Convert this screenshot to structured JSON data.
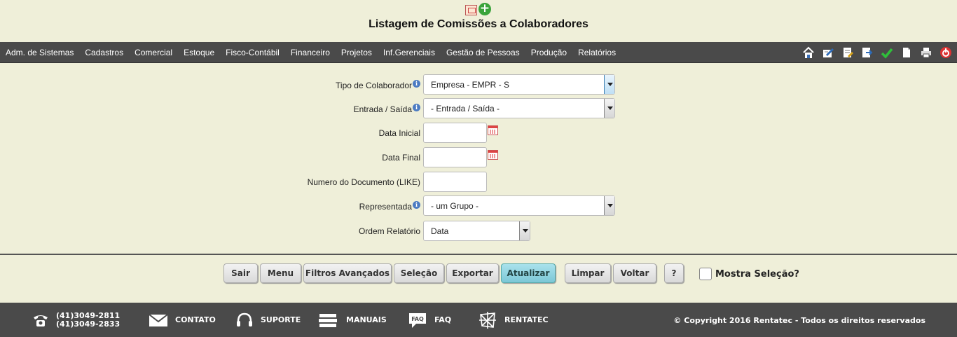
{
  "page": {
    "title": "Listagem de Comissões a Colaboradores"
  },
  "menu": [
    "Adm. de Sistemas",
    "Cadastros",
    "Comercial",
    "Estoque",
    "Fisco-Contábil",
    "Financeiro",
    "Projetos",
    "Inf.Gerenciais",
    "Gestão de Pessoas",
    "Produção",
    "Relatórios"
  ],
  "toolbar_icons": [
    "home-icon",
    "edit-icon",
    "notes-icon",
    "export-icon",
    "check-icon",
    "document-icon",
    "print-icon",
    "power-icon"
  ],
  "form": {
    "tipo_colaborador": {
      "label": "Tipo de Colaborador",
      "value": "Empresa - EMPR - S"
    },
    "entrada_saida": {
      "label": "Entrada / Saída",
      "value": "- Entrada / Saída -"
    },
    "data_inicial": {
      "label": "Data Inicial",
      "value": ""
    },
    "data_final": {
      "label": "Data Final",
      "value": ""
    },
    "numero_documento": {
      "label": "Numero do Documento (LIKE)",
      "value": ""
    },
    "representada": {
      "label": "Representada",
      "value": "- um Grupo -"
    },
    "ordem_relatorio": {
      "label": "Ordem Relatório",
      "value": "Data"
    }
  },
  "buttons": {
    "sair": "Sair",
    "menu": "Menu",
    "filtros": "Filtros Avançados",
    "selecao": "Seleção",
    "exportar": "Exportar",
    "atualizar": "Atualizar",
    "limpar": "Limpar",
    "voltar": "Voltar",
    "help": "?"
  },
  "mostra_selecao": {
    "label": "Mostra Seleção?",
    "checked": false
  },
  "footer": {
    "phone1": "(41)3049-2811",
    "phone2": "(41)3049-2833",
    "contato": "CONTATO",
    "suporte": "SUPORTE",
    "manuais": "MANUAIS",
    "faq": "FAQ",
    "faq_icon_text": "FAQ",
    "rentatec": "RENTATEC",
    "copyright": "© Copyright 2016 Rentatec - Todos os direitos reservados"
  },
  "colors": {
    "background": "#efefd9",
    "bar": "#4a4a4a",
    "accent_button": "#8fd3df"
  }
}
